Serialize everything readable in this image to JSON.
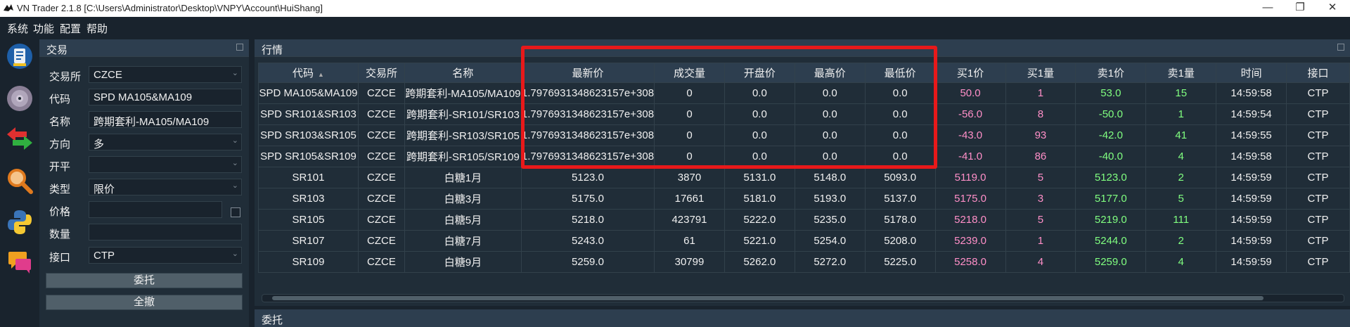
{
  "window": {
    "title": "VN Trader 2.1.8 [C:\\Users\\Administrator\\Desktop\\VNPY\\Account\\HuiShang]",
    "buttons": [
      "—",
      "❐",
      "✕"
    ]
  },
  "menu": [
    "系统",
    "功能",
    "配置",
    "帮助"
  ],
  "toolbar": [
    "contract-icon",
    "cd-icon",
    "arrows-icon",
    "magnifier-icon",
    "python-icon",
    "chat-icon"
  ],
  "trade_panel": {
    "title": "交易",
    "fields": [
      {
        "label": "交易所",
        "value": "CZCE",
        "kind": "combo"
      },
      {
        "label": "代码",
        "value": "SPD MA105&MA109",
        "kind": "input"
      },
      {
        "label": "名称",
        "value": "跨期套利-MA105/MA109",
        "kind": "input"
      },
      {
        "label": "方向",
        "value": "多",
        "kind": "combo"
      },
      {
        "label": "开平",
        "value": "",
        "kind": "combo"
      },
      {
        "label": "类型",
        "value": "限价",
        "kind": "combo"
      },
      {
        "label": "价格",
        "value": "",
        "kind": "input"
      },
      {
        "label": "数量",
        "value": "",
        "kind": "input"
      },
      {
        "label": "接口",
        "value": "CTP",
        "kind": "combo"
      }
    ],
    "send_button": "委托",
    "cancel_all_button": "全撤"
  },
  "market_panel": {
    "title": "行情",
    "columns": [
      "代码",
      "交易所",
      "名称",
      "最新价",
      "成交量",
      "开盘价",
      "最高价",
      "最低价",
      "买1价",
      "买1量",
      "卖1价",
      "卖1量",
      "时间",
      "接口"
    ],
    "rows": [
      [
        "SPD MA105&MA109",
        "CZCE",
        "跨期套利-MA105/MA109",
        "1.7976931348623157e+308",
        "0",
        "0.0",
        "0.0",
        "0.0",
        "50.0",
        "1",
        "53.0",
        "15",
        "14:59:58",
        "CTP"
      ],
      [
        "SPD SR101&SR103",
        "CZCE",
        "跨期套利-SR101/SR103",
        "1.7976931348623157e+308",
        "0",
        "0.0",
        "0.0",
        "0.0",
        "-56.0",
        "8",
        "-50.0",
        "1",
        "14:59:54",
        "CTP"
      ],
      [
        "SPD SR103&SR105",
        "CZCE",
        "跨期套利-SR103/SR105",
        "1.7976931348623157e+308",
        "0",
        "0.0",
        "0.0",
        "0.0",
        "-43.0",
        "93",
        "-42.0",
        "41",
        "14:59:55",
        "CTP"
      ],
      [
        "SPD SR105&SR109",
        "CZCE",
        "跨期套利-SR105/SR109",
        "1.7976931348623157e+308",
        "0",
        "0.0",
        "0.0",
        "0.0",
        "-41.0",
        "86",
        "-40.0",
        "4",
        "14:59:58",
        "CTP"
      ],
      [
        "SR101",
        "CZCE",
        "白糖1月",
        "5123.0",
        "3870",
        "5131.0",
        "5148.0",
        "5093.0",
        "5119.0",
        "5",
        "5123.0",
        "2",
        "14:59:59",
        "CTP"
      ],
      [
        "SR103",
        "CZCE",
        "白糖3月",
        "5175.0",
        "17661",
        "5181.0",
        "5193.0",
        "5137.0",
        "5175.0",
        "3",
        "5177.0",
        "5",
        "14:59:59",
        "CTP"
      ],
      [
        "SR105",
        "CZCE",
        "白糖5月",
        "5218.0",
        "423791",
        "5222.0",
        "5235.0",
        "5178.0",
        "5218.0",
        "5",
        "5219.0",
        "111",
        "14:59:59",
        "CTP"
      ],
      [
        "SR107",
        "CZCE",
        "白糖7月",
        "5243.0",
        "61",
        "5221.0",
        "5254.0",
        "5208.0",
        "5239.0",
        "1",
        "5244.0",
        "2",
        "14:59:59",
        "CTP"
      ],
      [
        "SR109",
        "CZCE",
        "白糖9月",
        "5259.0",
        "30799",
        "5262.0",
        "5272.0",
        "5225.0",
        "5258.0",
        "4",
        "5259.0",
        "4",
        "14:59:59",
        "CTP"
      ]
    ]
  },
  "order_panel": {
    "title": "委托"
  },
  "colors": {
    "bid": "#ff8fc8",
    "ask": "#80ff80",
    "highlight": "#e8191a",
    "background": "#19232d",
    "panel": "#202d38"
  }
}
